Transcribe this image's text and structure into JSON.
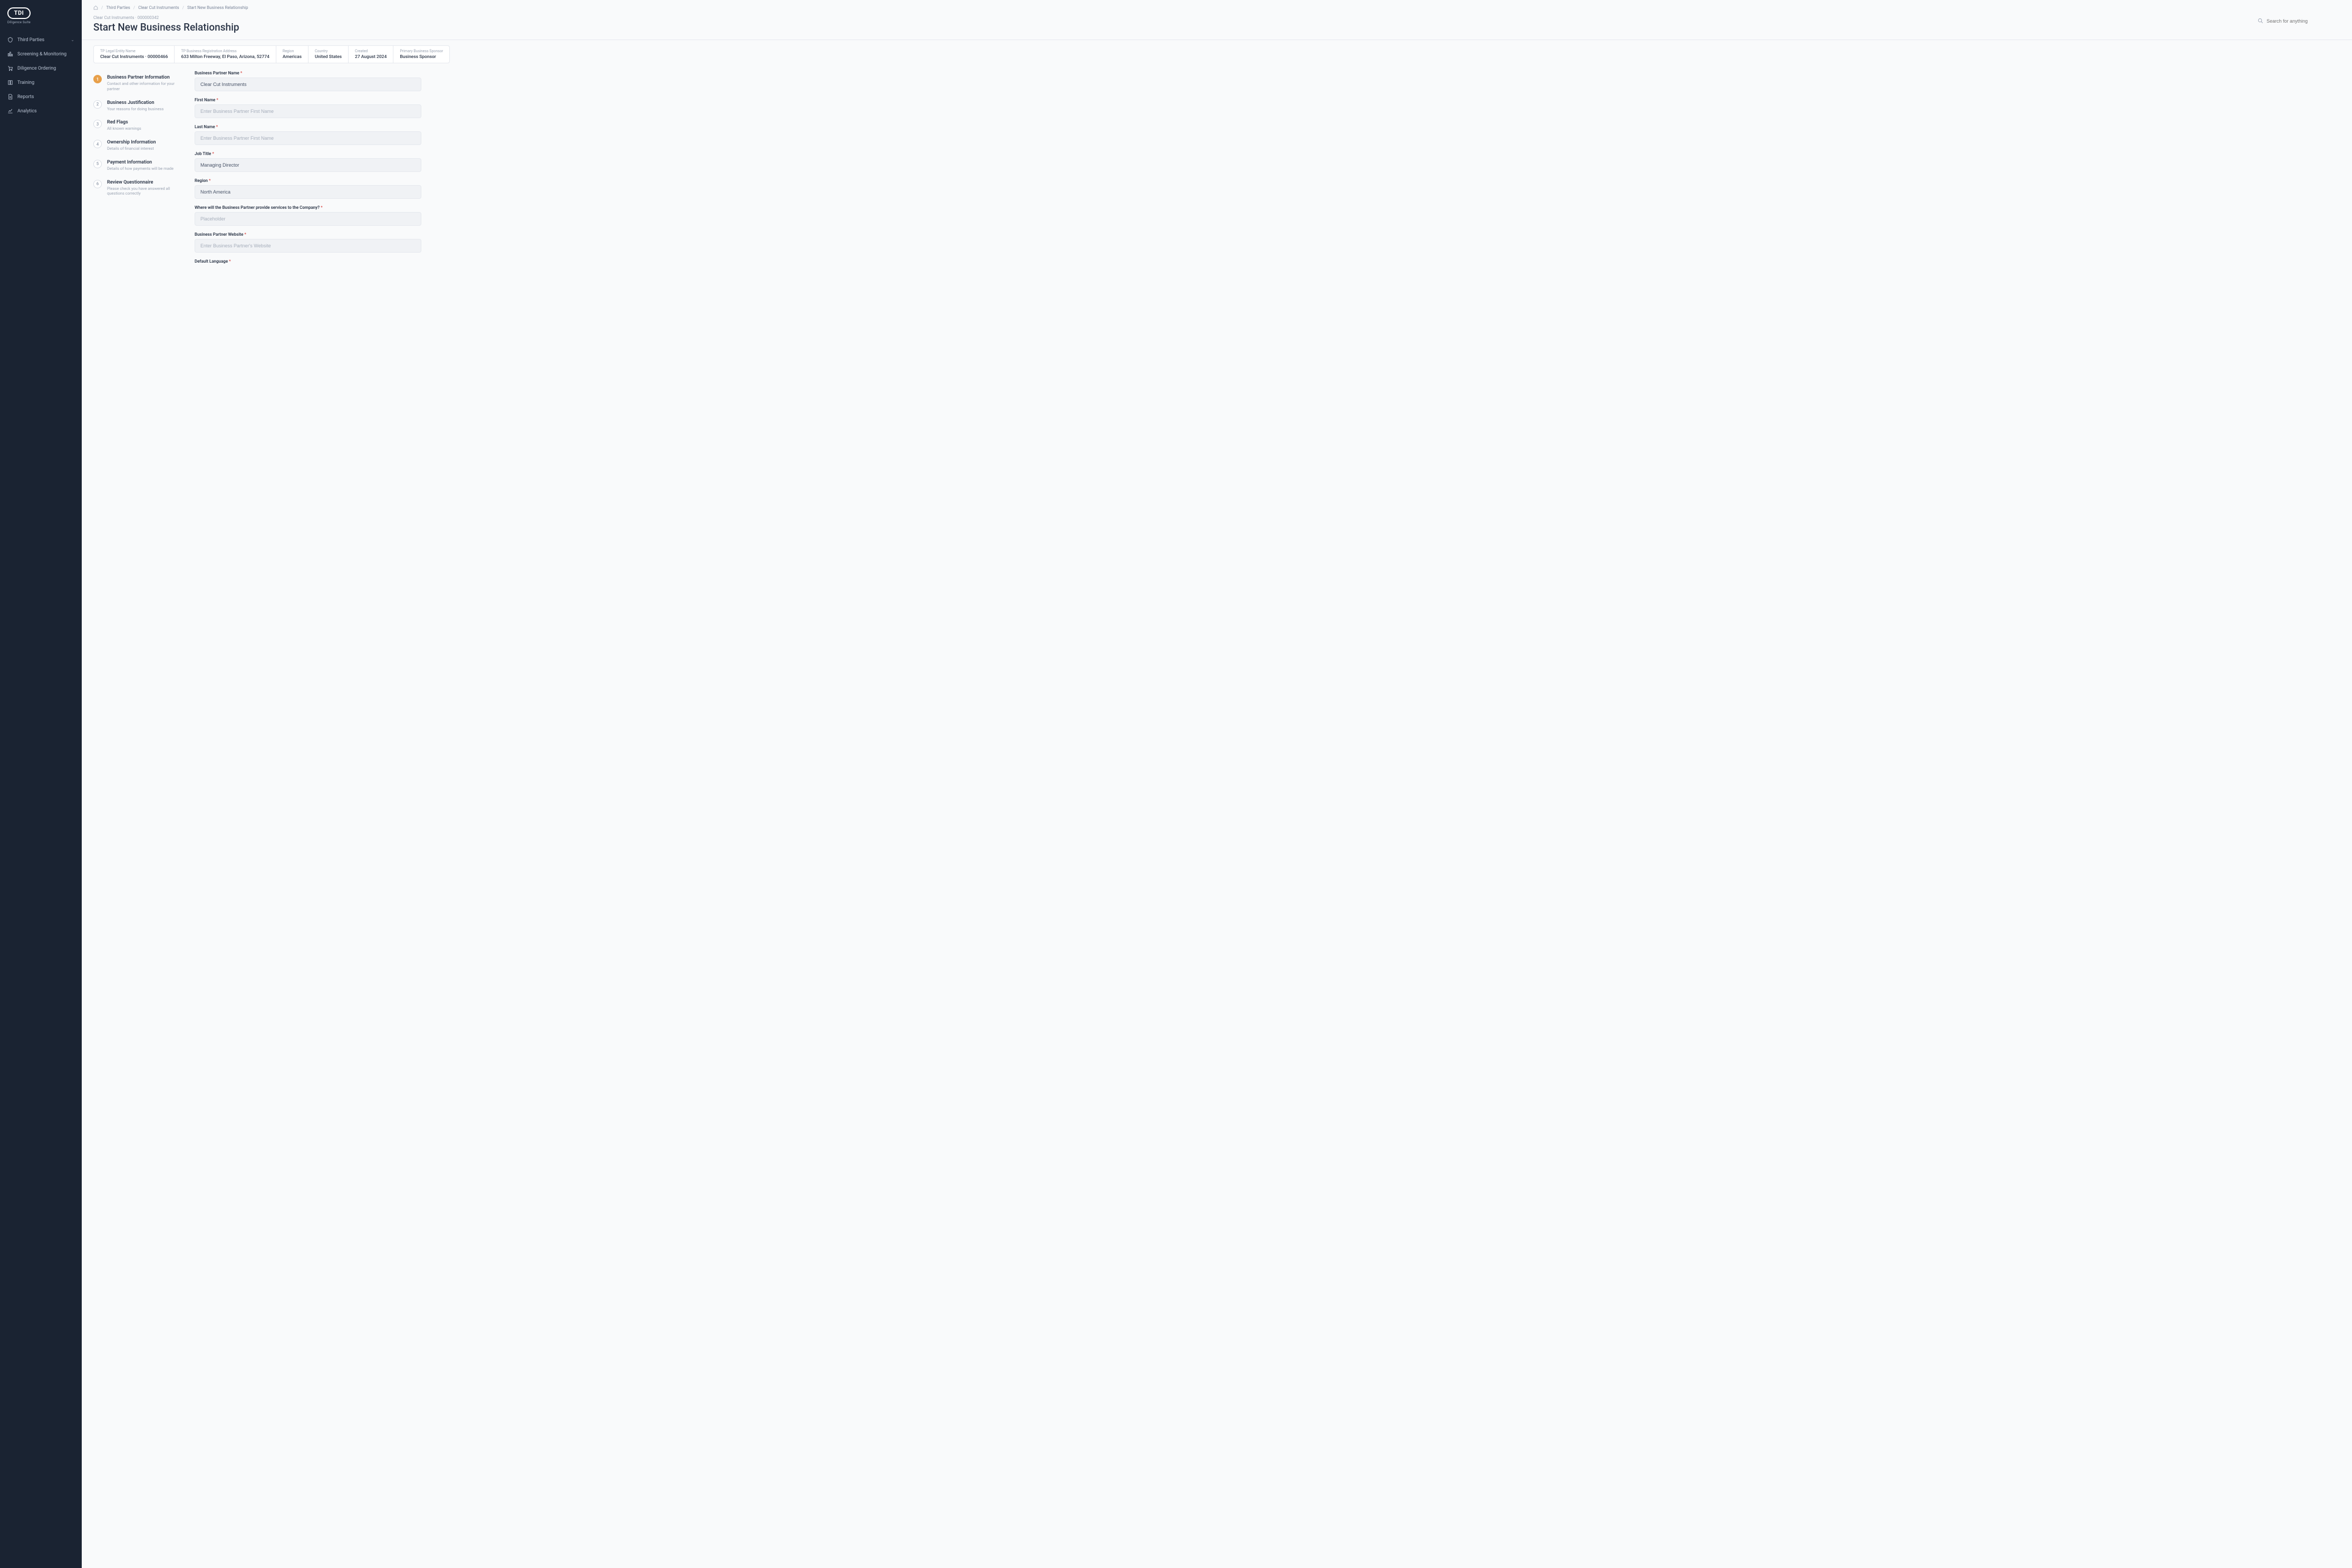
{
  "brand": {
    "name": "TDI",
    "subline": "Diligence Suite"
  },
  "sidebar": {
    "items": [
      {
        "label": "Third Parties",
        "icon": "shield",
        "has_children": true
      },
      {
        "label": "Screening & Monitoring",
        "icon": "chart"
      },
      {
        "label": "Diligence Ordering",
        "icon": "cart"
      },
      {
        "label": "Training",
        "icon": "book"
      },
      {
        "label": "Reports",
        "icon": "doc"
      },
      {
        "label": "Analytics",
        "icon": "line"
      }
    ]
  },
  "breadcrumb": {
    "home": "Home",
    "items": [
      "Third Parties",
      "Clear Cut Instruments",
      "Start New Business Relationship"
    ]
  },
  "header": {
    "subtitle": "Clear Cut Instruments · 000000342",
    "title": "Start New Business Relationship"
  },
  "search": {
    "placeholder": "Search for anything"
  },
  "meta": [
    {
      "label": "TP Legal Entity Name",
      "value": "Clear Cut Instruments · 00000466"
    },
    {
      "label": "TP Business Registration Address",
      "value": "633 Milton Freeway, El Paso, Arizona, 52774"
    },
    {
      "label": "Region",
      "value": "Americas"
    },
    {
      "label": "Country",
      "value": "United States"
    },
    {
      "label": "Created",
      "value": "27 August 2024"
    },
    {
      "label": "Primary Business Sponsor",
      "value": "Business Sponsor"
    }
  ],
  "steps": [
    {
      "num": "1",
      "title": "Business Partner Information",
      "desc": "Contact and other information for your partner"
    },
    {
      "num": "2",
      "title": "Business Justification",
      "desc": "Your reasons for doing business"
    },
    {
      "num": "3",
      "title": "Red Flags",
      "desc": "All known warnings"
    },
    {
      "num": "4",
      "title": "Ownership Information",
      "desc": "Details of financial interest"
    },
    {
      "num": "5",
      "title": "Payment Information",
      "desc": "Details of how payments will be made"
    },
    {
      "num": "6",
      "title": "Review Questionnaire",
      "desc": "Please check you have answered all questions correctly"
    }
  ],
  "form": {
    "business_partner_name": {
      "label": "Business Partner Name",
      "value": "Clear Cut Instruments"
    },
    "first_name": {
      "label": "First Name",
      "placeholder": "Enter Business Partner First Name"
    },
    "last_name": {
      "label": "Last Name",
      "placeholder": "Enter Business Partner First Name"
    },
    "job_title": {
      "label": "Job Title",
      "value": "Managing Director"
    },
    "region": {
      "label": "Region",
      "value": "North America"
    },
    "where_services": {
      "label": "Where will the Business Partner provide services to the Company?",
      "placeholder": "Placeholder"
    },
    "website": {
      "label": "Business Partner Website",
      "placeholder": "Enter Business Partner's Website"
    },
    "default_language": {
      "label": "Default Language"
    }
  }
}
